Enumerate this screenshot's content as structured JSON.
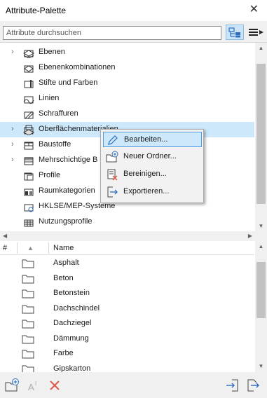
{
  "window": {
    "title": "Attribute-Palette",
    "close_glyph": "✕"
  },
  "search": {
    "placeholder": "Attribute durchsuchen",
    "value": ""
  },
  "tree": {
    "items": [
      {
        "label": "Ebenen",
        "expandable": true,
        "icon": "layers-icon"
      },
      {
        "label": "Ebenenkombinationen",
        "expandable": false,
        "icon": "layer-combinations-icon"
      },
      {
        "label": "Stifte und Farben",
        "expandable": false,
        "icon": "pens-colors-icon"
      },
      {
        "label": "Linien",
        "expandable": false,
        "icon": "lines-icon"
      },
      {
        "label": "Schraffuren",
        "expandable": false,
        "icon": "fills-icon"
      },
      {
        "label": "Oberflächenmaterialien",
        "expandable": true,
        "icon": "surfaces-icon",
        "selected": true
      },
      {
        "label": "Baustoffe",
        "expandable": true,
        "icon": "building-materials-icon"
      },
      {
        "label": "Mehrschichtige B",
        "expandable": true,
        "icon": "composites-icon"
      },
      {
        "label": "Profile",
        "expandable": false,
        "icon": "profiles-icon"
      },
      {
        "label": "Raumkategorien",
        "expandable": false,
        "icon": "zone-categories-icon"
      },
      {
        "label": "HKLSE/MEP-Systeme",
        "expandable": false,
        "icon": "mep-systems-icon"
      },
      {
        "label": "Nutzungsprofile",
        "expandable": false,
        "icon": "operation-profiles-icon"
      }
    ]
  },
  "context_menu": {
    "items": [
      {
        "label": "Bearbeiten...",
        "icon": "pencil-icon",
        "hover": true
      },
      {
        "label": "Neuer Ordner...",
        "icon": "new-folder-icon"
      },
      {
        "label": "Bereinigen...",
        "icon": "purge-icon"
      },
      {
        "label": "Exportieren...",
        "icon": "export-icon"
      }
    ]
  },
  "table": {
    "headers": {
      "hash": "#",
      "sort_glyph": "▲",
      "name": "Name"
    },
    "rows": [
      "Asphalt",
      "Beton",
      "Betonstein",
      "Dachschindel",
      "Dachziegel",
      "Dämmung",
      "Farbe",
      "Gipskarton"
    ]
  },
  "colors": {
    "selection": "#cde8fb",
    "accent": "#4c9ae0",
    "delete_red": "#e05a4a",
    "icon_blue": "#2a6ebd"
  }
}
